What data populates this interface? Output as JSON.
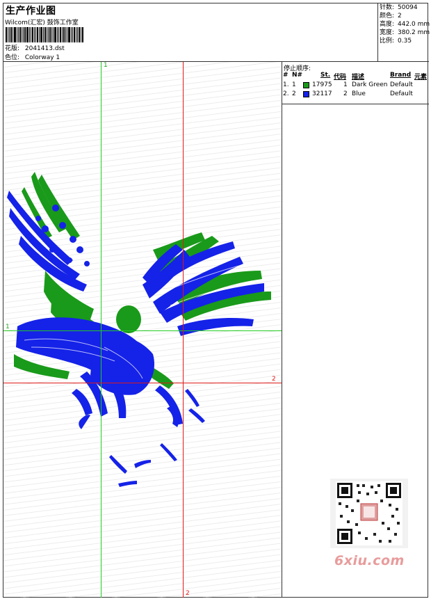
{
  "header": {
    "title": "生产作业图",
    "company": "Wilcom(汇宏) 鼓饰工作室",
    "file_label": "花版:",
    "file_name": "2041413.dst",
    "color_label": "色位:",
    "colorway": "Colorway 1"
  },
  "specs": {
    "stitches_label": "针数:",
    "stitches": "50094",
    "colors_label": "颜色:",
    "colors": "2",
    "height_label": "高度:",
    "height": "442.0 mm",
    "width_label": "宽度:",
    "width": "380.2 mm",
    "scale_label": "比例:",
    "scale": "0.35"
  },
  "stop_sequence": {
    "title": "停止顺序:",
    "columns": {
      "hash": "#",
      "n": "N#",
      "st": "St.",
      "code": "代码",
      "desc": "描述",
      "brand": "Brand",
      "element": "元素"
    },
    "rows": [
      {
        "hash": "1.",
        "n": "1",
        "color": "#1a9a1a",
        "st": "17975",
        "code": "1",
        "desc": "Dark Green",
        "brand": "Default"
      },
      {
        "hash": "2.",
        "n": "2",
        "color": "#1522e8",
        "st": "32117",
        "code": "2",
        "desc": "Blue",
        "brand": "Default"
      }
    ]
  },
  "guides": {
    "v1_label": "1",
    "h1_label": "1",
    "h2_label": "2",
    "v2_label": "2",
    "green": "#22cc22",
    "red": "#e01818"
  },
  "watermark": "6xiu.com",
  "colors": {
    "green": "#1a9a1a",
    "blue": "#1522e8"
  }
}
